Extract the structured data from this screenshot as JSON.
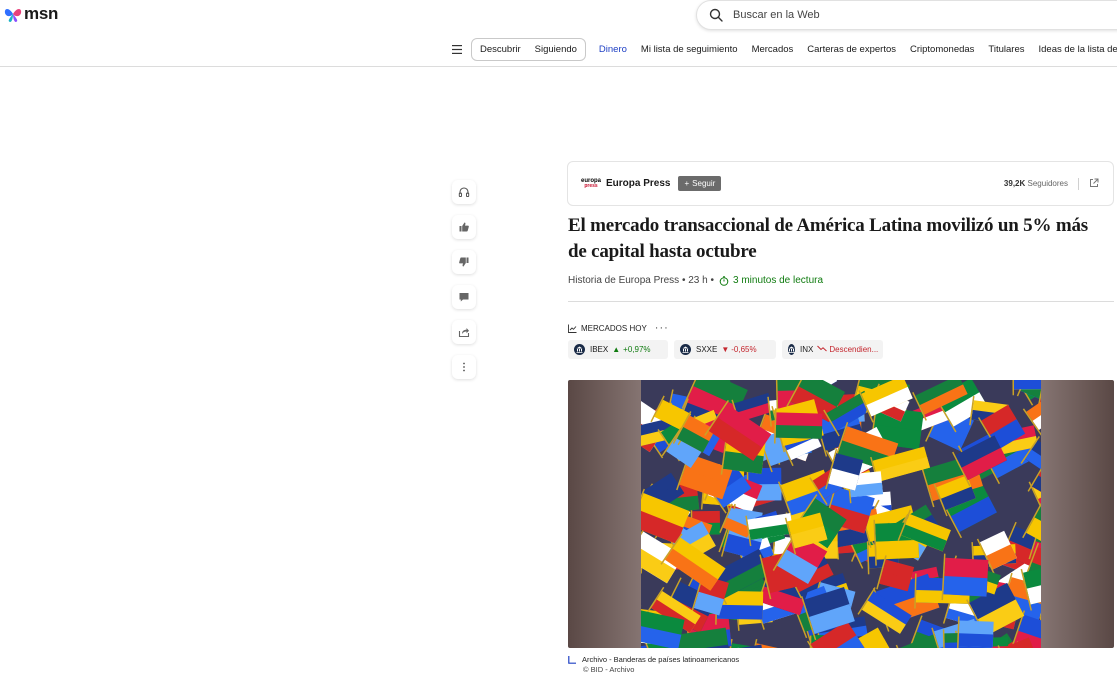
{
  "header": {
    "logo_text": "msn",
    "search_placeholder": "Buscar en la Web"
  },
  "nav": {
    "segments": [
      "Descubrir",
      "Siguiendo"
    ],
    "items": [
      "Dinero",
      "Mi lista de seguimiento",
      "Mercados",
      "Carteras de expertos",
      "Criptomonedas",
      "Titulares",
      "Ideas de la lista de seguimiento"
    ],
    "active_item": "Dinero"
  },
  "publisher": {
    "logo_top": "europa",
    "logo_bottom": "press",
    "name": "Europa Press",
    "follow_label": "Seguir",
    "followers_count": "39,2K",
    "followers_label": "Seguidores"
  },
  "article": {
    "title": "El mercado transaccional de América Latina movilizó un 5% más de capital hasta octubre",
    "byline": "Historia de Europa Press",
    "age": "23 h",
    "read_time": "3 minutos de lectura"
  },
  "markets": {
    "header": "MERCADOS HOY",
    "tickers": [
      {
        "symbol": "IBEX",
        "change": "+0,97%",
        "trend": "up"
      },
      {
        "symbol": "SXXE",
        "change": "-0,65%",
        "trend": "down"
      },
      {
        "symbol": "INX",
        "change": "Descendien...",
        "trend": "down"
      }
    ]
  },
  "image": {
    "caption": "Archivo - Banderas de países latinoamericanos",
    "credit": "© BID - Archivo"
  },
  "colors": {
    "accent_blue": "#1f40c4",
    "up_green": "#0f7b0f",
    "down_red": "#c4262e"
  }
}
